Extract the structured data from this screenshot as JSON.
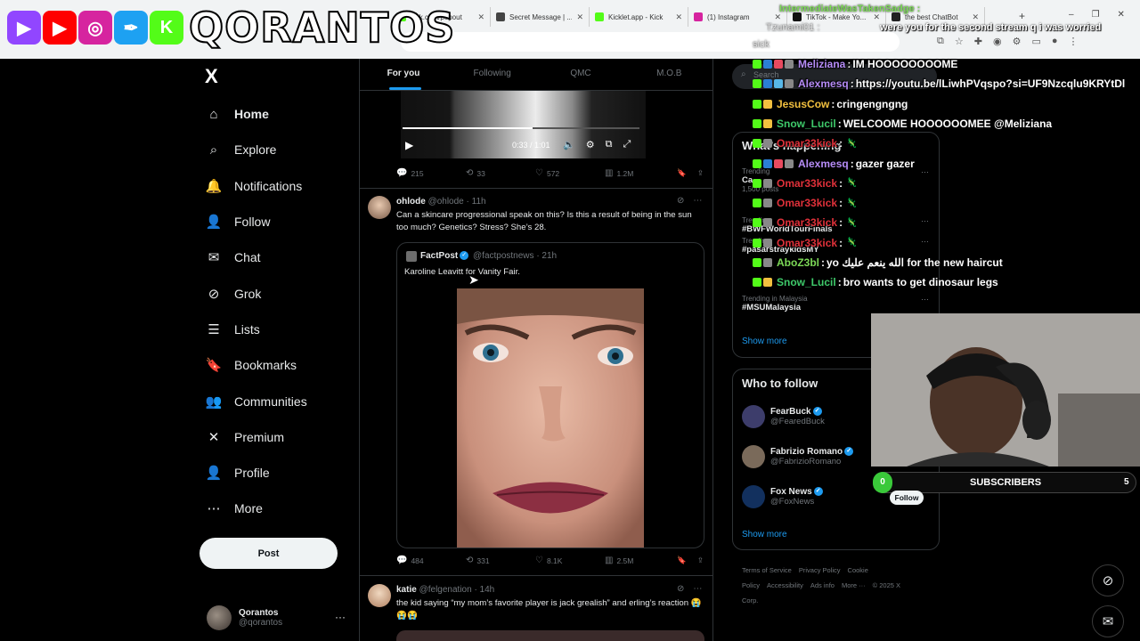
{
  "browser": {
    "tabs": [
      {
        "label": "kick.com/popout",
        "color": "#53fc18"
      },
      {
        "label": "Secret Message | ...",
        "color": "#444444"
      },
      {
        "label": "Kicklet.app - Kick",
        "color": "#53fc18"
      },
      {
        "label": "(1) Instagram",
        "color": "#d6249f"
      },
      {
        "label": "TikTok - Make Yo...",
        "color": "#111111"
      },
      {
        "label": "the best ChatBot",
        "color": "#222222"
      }
    ],
    "new_tab": "+",
    "window_controls": [
      "–",
      "❐",
      "✕"
    ]
  },
  "stream_logo": {
    "text": "QORANTOS",
    "badges": [
      {
        "glyph": "▶",
        "color": "#9146ff"
      },
      {
        "glyph": "▶",
        "color": "#ff0000"
      },
      {
        "glyph": "◎",
        "color": "#d6249f"
      },
      {
        "glyph": "✒",
        "color": "#1da1f2"
      },
      {
        "glyph": "K",
        "color": "#53fc18"
      }
    ]
  },
  "x_logo": "X",
  "nav": {
    "items": [
      {
        "label": "Home",
        "icon": "home-icon",
        "glyph": "⌂",
        "active": true
      },
      {
        "label": "Explore",
        "icon": "search-icon",
        "glyph": "⌕"
      },
      {
        "label": "Notifications",
        "icon": "bell-icon",
        "glyph": "🔔"
      },
      {
        "label": "Follow",
        "icon": "follow-icon",
        "glyph": "👤"
      },
      {
        "label": "Chat",
        "icon": "mail-icon",
        "glyph": "✉"
      },
      {
        "label": "Grok",
        "icon": "grok-icon",
        "glyph": "⊘"
      },
      {
        "label": "Lists",
        "icon": "list-icon",
        "glyph": "☰"
      },
      {
        "label": "Bookmarks",
        "icon": "bookmark-icon",
        "glyph": "🔖"
      },
      {
        "label": "Communities",
        "icon": "communities-icon",
        "glyph": "👥"
      },
      {
        "label": "Premium",
        "icon": "x-icon",
        "glyph": "✕"
      },
      {
        "label": "Profile",
        "icon": "profile-icon",
        "glyph": "👤"
      },
      {
        "label": "More",
        "icon": "more-icon",
        "glyph": "⋯"
      }
    ],
    "post_button": "Post",
    "account": {
      "name": "Qorantos",
      "handle": "@qorantos",
      "more": "···"
    }
  },
  "timeline": {
    "tabs": [
      "For you",
      "Following",
      "QMC",
      "M.O.B"
    ],
    "video": {
      "time": "0:33 / 1:01",
      "progress": 0.55
    },
    "tweet0_stats": {
      "replies": "215",
      "reposts": "33",
      "likes": "572",
      "views": "1.2M"
    },
    "tweet1": {
      "name": "ohlode",
      "handle": "@ohlode",
      "time": "· 11h",
      "text": "Can a skincare progressional speak on this? Is this a result of being in the sun too much? Genetics? Stress? She’s 28.",
      "quote": {
        "name": "FactPost",
        "handle": "@factpostnews",
        "time": "· 21h",
        "text": "Karoline Leavitt for Vanity Fair."
      },
      "stats": {
        "replies": "484",
        "reposts": "331",
        "likes": "8.1K",
        "views": "2.5M"
      }
    },
    "tweet2": {
      "name": "katie",
      "handle": "@felgenation",
      "time": "· 14h",
      "text": "the kid saying “my mom’s favorite player is jack grealish” and erling’s reaction 😭😭😭"
    }
  },
  "right": {
    "search_placeholder": "Search",
    "trends_title": "What’s happening",
    "trends": [
      {
        "context": "Trending",
        "name": "Ca... ",
        "extra": "1,500 posts"
      },
      {
        "context": "Trending",
        "name": "#BWFWorldTourFinals"
      },
      {
        "context": "Trending",
        "name": "#pasarstraykidsMY"
      },
      {
        "context": "Trending in Malaysia",
        "name": "#MSUMalaysia"
      }
    ],
    "show_more": "Show more",
    "who_to_follow_title": "Who to follow",
    "who_to_follow": [
      {
        "name": "FearBuck",
        "handle": "@FearedBuck",
        "color": "#3d3d6b"
      },
      {
        "name": "Fabrizio Romano",
        "handle": "@FabrizioRomano",
        "color": "#7a6a5a"
      },
      {
        "name": "Fox News",
        "handle": "@FoxNews",
        "color": "#12305e"
      }
    ],
    "footer": [
      "Terms of Service",
      "Privacy Policy",
      "Cookie Policy",
      "Accessibility",
      "Ads info",
      "More ···",
      "© 2025 X Corp."
    ]
  },
  "chat": {
    "header_user": "IntermediateWasTakenSadge :",
    "header_user2": "Tzunami01 :",
    "header_msg": "were you for the second stream q i was worried",
    "header_msg2": "sick",
    "lines": [
      {
        "user": "Meliziana",
        "color": "#b68cf7",
        "msg": "IM HOOOOOOOOME"
      },
      {
        "user": "Alexmesq",
        "color": "#b68cf7",
        "msg": "https://youtu.be/lLiwhPVqspo?si=UF9Nzcqlu9KRYtDl"
      },
      {
        "user": "JesusCow",
        "color": "#f2c03f",
        "msg": "cringengngng"
      },
      {
        "user": "Snow_Lucil",
        "color": "#3ec96a",
        "msg": "WELCOOME HOOOOOOMEE @Meliziana"
      },
      {
        "user": "Omar33kick",
        "color": "#e0313a",
        "msg": ""
      },
      {
        "user": "Alexmesq",
        "color": "#b68cf7",
        "msg": "gazer gazer"
      },
      {
        "user": "Omar33kick",
        "color": "#e0313a",
        "msg": ""
      },
      {
        "user": "Omar33kick",
        "color": "#e0313a",
        "msg": ""
      },
      {
        "user": "Omar33kick",
        "color": "#e0313a",
        "msg": ""
      },
      {
        "user": "Omar33kick",
        "color": "#e0313a",
        "msg": ""
      },
      {
        "user": "AboZ3bl",
        "color": "#7cd957",
        "msg": "yo الله ينعم عليك for the new haircut"
      },
      {
        "user": "Snow_Lucil",
        "color": "#3ec96a",
        "msg": "bro wants to get dinosaur legs"
      }
    ]
  },
  "overlay": {
    "subscribers_label": "SUBSCRIBERS",
    "sub_start": "0",
    "sub_goal": "5",
    "follow": "Follow"
  }
}
